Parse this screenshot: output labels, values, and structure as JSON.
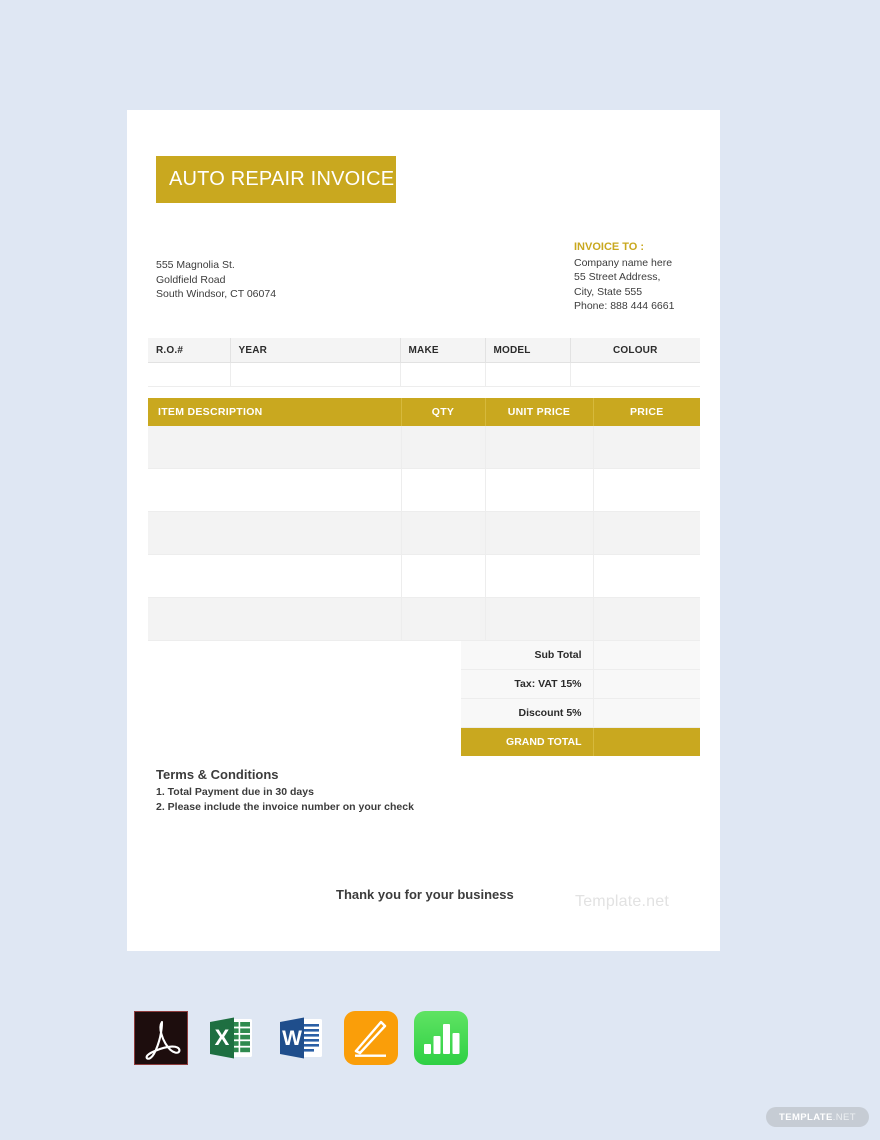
{
  "colors": {
    "gold": "#c9a81f",
    "page_background": "#dfe7f3",
    "sheet": "#ffffff",
    "row_shaded": "#f3f3f3",
    "text": "#3c3c3c"
  },
  "invoice": {
    "title": "AUTO REPAIR INVOICE",
    "from_address": {
      "line1": "555 Magnolia St.",
      "line2": "Goldfield Road",
      "line3": "South Windsor, CT 06074"
    },
    "invoice_to": {
      "label": "INVOICE TO :",
      "line1": "Company name here",
      "line2": "55 Street Address,",
      "line3": "City, State 555",
      "line4": "Phone: 888 444 6661"
    },
    "vehicle_table": {
      "headers": [
        "R.O.#",
        "YEAR",
        "MAKE",
        "MODEL",
        "COLOUR"
      ],
      "rows": [
        [
          "",
          "",
          "",
          "",
          ""
        ]
      ]
    },
    "items_table": {
      "headers": [
        "ITEM DESCRIPTION",
        "QTY",
        "UNIT PRICE",
        "PRICE"
      ],
      "rows": [
        [
          "",
          "",
          "",
          ""
        ],
        [
          "",
          "",
          "",
          ""
        ],
        [
          "",
          "",
          "",
          ""
        ],
        [
          "",
          "",
          "",
          ""
        ],
        [
          "",
          "",
          "",
          ""
        ]
      ]
    },
    "totals": [
      {
        "label": "Sub Total",
        "value": ""
      },
      {
        "label": "Tax: VAT 15%",
        "value": ""
      },
      {
        "label": "Discount 5%",
        "value": ""
      },
      {
        "label": "GRAND TOTAL",
        "value": ""
      }
    ],
    "terms": {
      "heading": "Terms & Conditions",
      "line1": "1. Total Payment due in 30 days",
      "line2": "2. Please include the invoice number on your check"
    },
    "thank_you": "Thank you for your business",
    "watermark": "Template.net"
  },
  "format_icons": [
    {
      "name": "pdf-icon",
      "label": "PDF"
    },
    {
      "name": "excel-icon",
      "label": "Excel"
    },
    {
      "name": "word-icon",
      "label": "Word"
    },
    {
      "name": "apple-pages-icon",
      "label": "Pages"
    },
    {
      "name": "apple-numbers-icon",
      "label": "Numbers"
    }
  ],
  "badge": {
    "main": "TEMPLATE",
    "tld": ".NET"
  }
}
